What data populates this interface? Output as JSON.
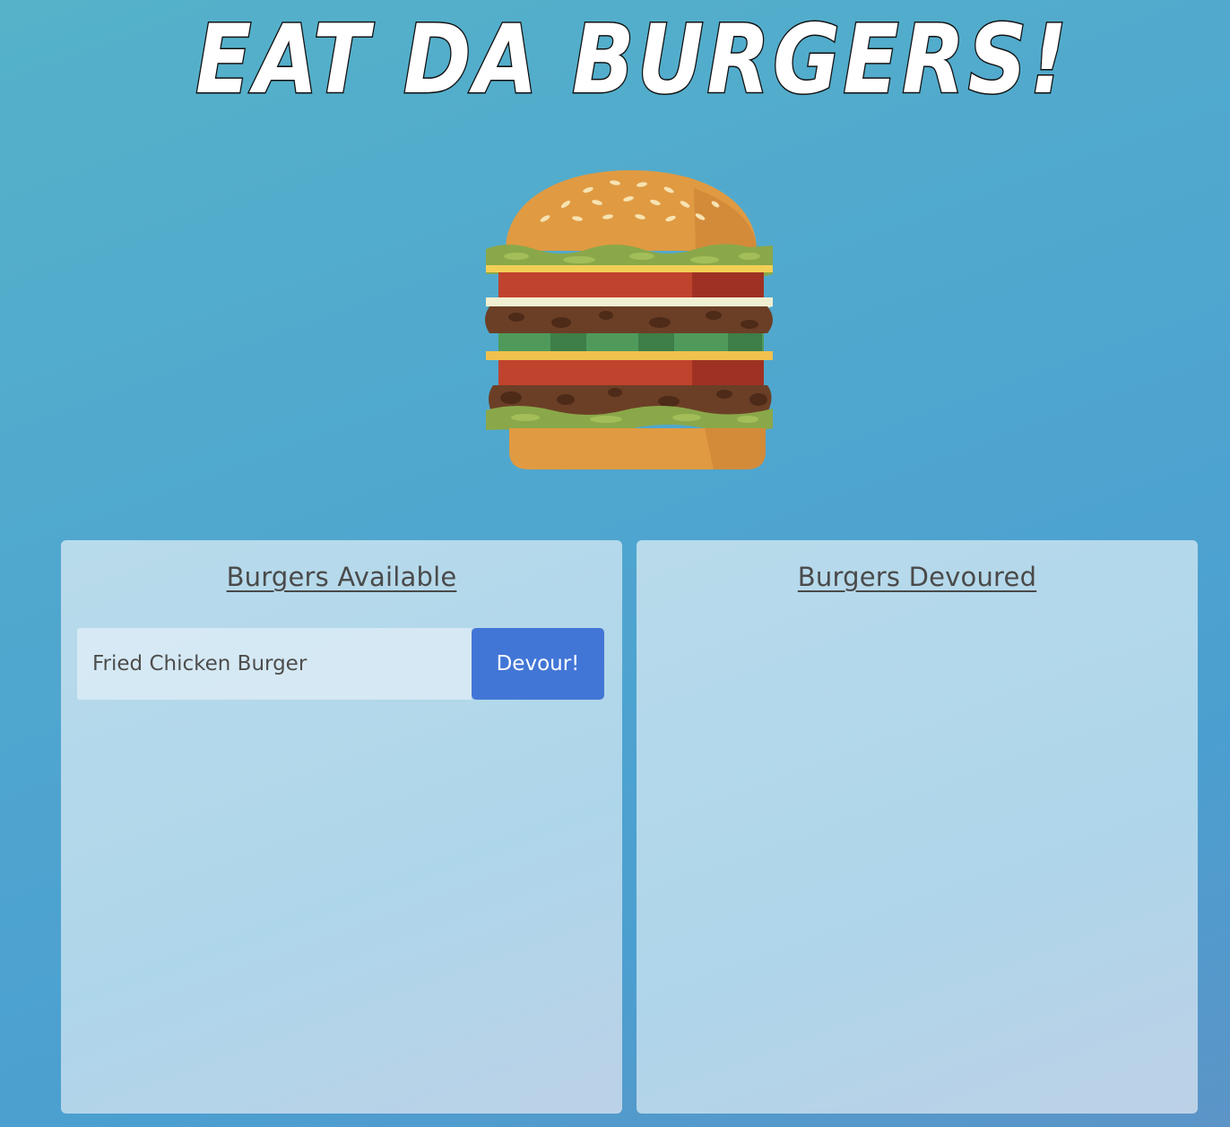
{
  "header": {
    "title": "EAT DA BURGERS!"
  },
  "hero": {
    "image": "hamburger-illustration"
  },
  "available": {
    "heading": "Burgers Available",
    "items": [
      {
        "name": "Fried Chicken Burger",
        "button_label": "Devour!"
      }
    ]
  },
  "devoured": {
    "heading": "Burgers Devoured",
    "items": []
  },
  "colors": {
    "background": "#4fa6cf",
    "button": "#4276d6",
    "panel": "#bcdcec",
    "text": "#4a4a4a"
  }
}
